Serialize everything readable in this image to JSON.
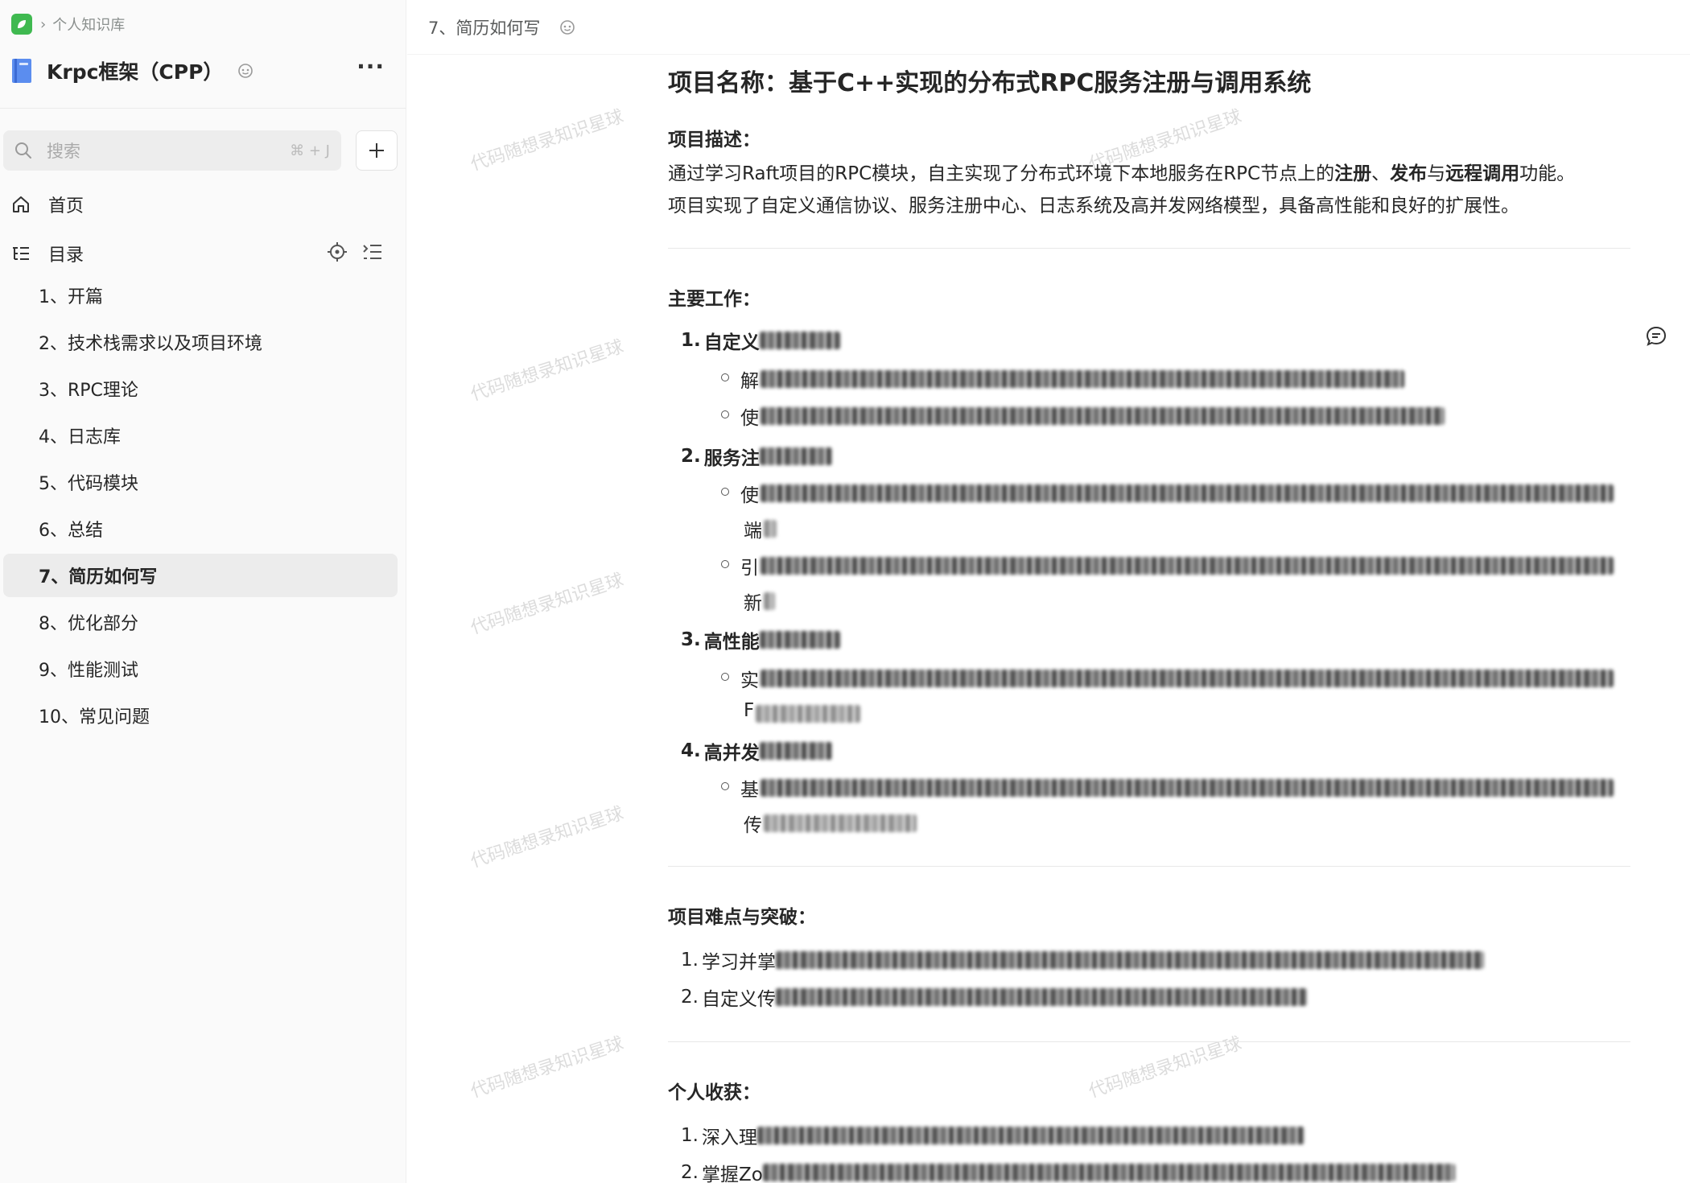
{
  "breadcrumb": {
    "label": "个人知识库"
  },
  "book": {
    "title": "Krpc框架（CPP）",
    "more": "···"
  },
  "search": {
    "placeholder": "搜索",
    "shortcut": "⌘ + J"
  },
  "nav": {
    "home": "首页",
    "toc": "目录"
  },
  "toc_items": [
    "1、开篇",
    "2、技术栈需求以及项目环境",
    "3、RPC理论",
    "4、日志库",
    "5、代码模块",
    "6、总结",
    "7、简历如何写",
    "8、优化部分",
    "9、性能测试",
    "10、常见问题"
  ],
  "active_toc_index": 6,
  "doc_tab": "7、简历如何写",
  "watermark": "代码随想录知识星球",
  "doc": {
    "heading": "项目名称：基于C++实现的分布式RPC服务注册与调用系统",
    "desc_title": "项目描述：",
    "desc_line1_a": "通过学习Raft项目的RPC模块，自主实现了分布式环境下本地服务在RPC节点上的",
    "desc_line1_b": "注册",
    "desc_line1_c": "、",
    "desc_line1_d": "发布",
    "desc_line1_e": "与",
    "desc_line1_f": "远程调用",
    "desc_line1_g": "功能。",
    "desc_line2": "项目实现了自定义通信协议、服务注册中心、日志系统及高并发网络模型，具备高性能和良好的扩展性。",
    "work_title": "主要工作：",
    "work_items": [
      {
        "num": "1.",
        "text": "自定义"
      },
      {
        "num": "2.",
        "text": "服务注"
      },
      {
        "num": "3.",
        "text": "高性能"
      },
      {
        "num": "4.",
        "text": "高并发"
      }
    ],
    "bullets": {
      "b1": "解",
      "b2": "使",
      "b3": "使",
      "b3b": "端",
      "b4": "引",
      "b4b": "新",
      "b5": "实",
      "b5b": "F",
      "b6": "基",
      "b6b": "传"
    },
    "diff_title": "项目难点与突破：",
    "diff_items": [
      {
        "num": "1.",
        "text": "学习并掌"
      },
      {
        "num": "2.",
        "text": "自定义传"
      }
    ],
    "gain_title": "个人收获：",
    "gain_items": [
      {
        "num": "1.",
        "text": "深入理"
      },
      {
        "num": "2.",
        "text": "掌握Zo"
      }
    ]
  },
  "colors": {
    "active_bg": "#ececec",
    "logo": "#3fb950",
    "book_icon": "#4b7be5"
  }
}
